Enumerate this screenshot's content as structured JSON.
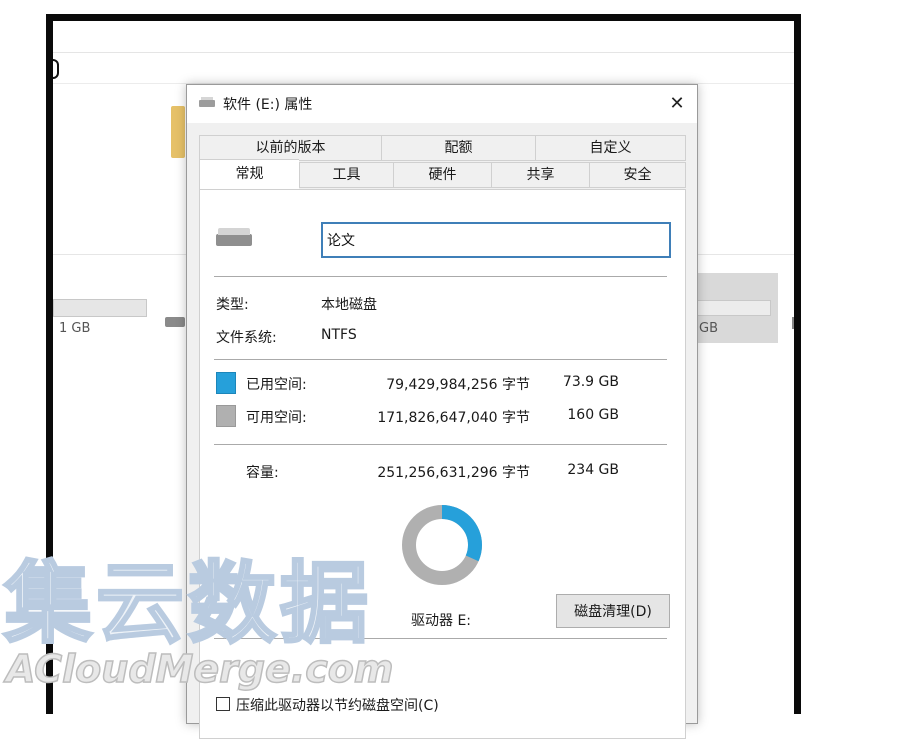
{
  "background": {
    "size_left": "1 GB",
    "size_right": "GB"
  },
  "dialog": {
    "title": "软件 (E:) 属性",
    "close_glyph": "✕",
    "tabs_row1": [
      "以前的版本",
      "配额",
      "自定义"
    ],
    "tabs_row2": [
      "常规",
      "工具",
      "硬件",
      "共享",
      "安全"
    ],
    "active_tab": "常规",
    "drive_name": "论文",
    "type_label": "类型:",
    "type_value": "本地磁盘",
    "fs_label": "文件系统:",
    "fs_value": "NTFS",
    "used_label": "已用空间:",
    "used_bytes": "79,429,984,256 字节",
    "used_size": "73.9 GB",
    "free_label": "可用空间:",
    "free_bytes": "171,826,647,040 字节",
    "free_size": "160 GB",
    "capacity_label": "容量:",
    "capacity_bytes": "251,256,631,296 字节",
    "capacity_size": "234 GB",
    "drive_letter_label": "驱动器 E:",
    "cleanup_button": "磁盘清理(D)",
    "compress_option": "压缩此驱动器以节约磁盘空间(C)",
    "used_fraction": 0.316,
    "colors": {
      "used": "#26a0da",
      "free": "#b0b0b0"
    },
    "icons": [
      "drive-icon",
      "close-icon",
      "checkbox"
    ]
  },
  "watermark": {
    "chinese": "集云数据",
    "english": "ACloudMerge.com"
  }
}
